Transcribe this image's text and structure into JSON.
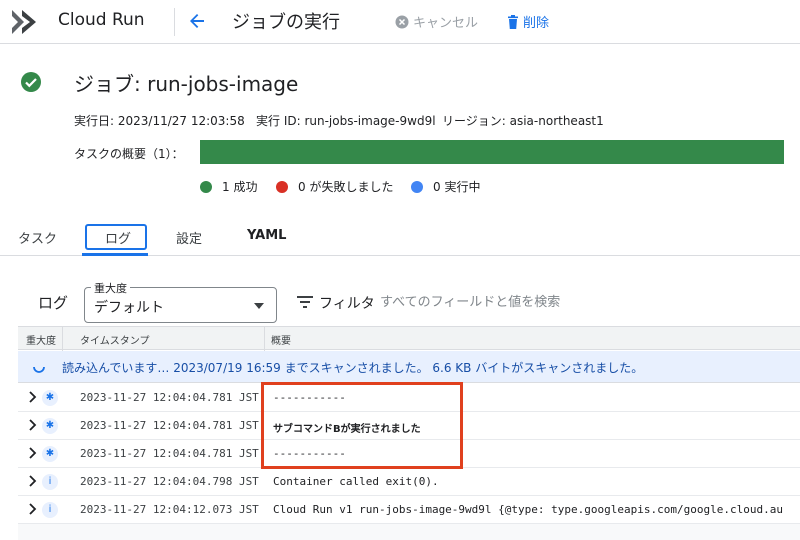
{
  "topbar": {
    "product_name": "Cloud Run",
    "page_title": "ジョブの実行",
    "cancel_label": "キャンセル",
    "delete_label": "削除"
  },
  "job": {
    "title": "ジョブ: run-jobs-image",
    "status": "succeeded",
    "executed_at": "実行日: 2023/11/27 12:03:58",
    "execution_id": "実行 ID: run-jobs-image-9wd9l",
    "region": "リージョン: asia-northeast1",
    "task_summary_label": "タスクの概要（1）：",
    "task_success_fraction": 1.0,
    "legend": [
      {
        "label": "1 成功",
        "color": "#34894a"
      },
      {
        "label": "0 が失敗しました",
        "color": "#d93025"
      },
      {
        "label": "0 実行中",
        "color": "#4285f4"
      }
    ]
  },
  "tabs": [
    {
      "label": "タスク",
      "active": false
    },
    {
      "label": "ログ",
      "active": true
    },
    {
      "label": "設定",
      "active": false
    },
    {
      "label": "YAML",
      "active": false
    }
  ],
  "logs": {
    "heading": "ログ",
    "severity": {
      "legend": "重大度",
      "value": "デフォルト"
    },
    "filter_label": "フィルタ",
    "filter_placeholder": "すべてのフィールドと値を検索",
    "columns": [
      "重大度",
      "タイムスタンプ",
      "概要"
    ],
    "loading_text": "読み込んでいます… 2023/07/19 16:59 までスキャンされました。 6.6 KB バイトがスキャンされました。",
    "rows": [
      {
        "severity_icon": "debug-icon",
        "timestamp": "2023-11-27 12:04:04.781 JST",
        "summary": "-----------"
      },
      {
        "severity_icon": "debug-icon",
        "timestamp": "2023-11-27 12:04:04.781 JST",
        "summary": "サブコマンドBが実行されました"
      },
      {
        "severity_icon": "debug-icon",
        "timestamp": "2023-11-27 12:04:04.781 JST",
        "summary": "-----------"
      },
      {
        "severity_icon": "info-icon",
        "timestamp": "2023-11-27 12:04:04.798 JST",
        "summary": "Container called exit(0)."
      },
      {
        "severity_icon": "info-icon",
        "timestamp": "2023-11-27 12:04:12.073 JST",
        "summary": "Cloud Run  v1  run-jobs-image-9wd9l    {@type: type.googleapis.com/google.cloud.au"
      }
    ]
  },
  "colors": {
    "accent": "#1a73e8",
    "success": "#34894a",
    "highlight": "#e0401e"
  }
}
